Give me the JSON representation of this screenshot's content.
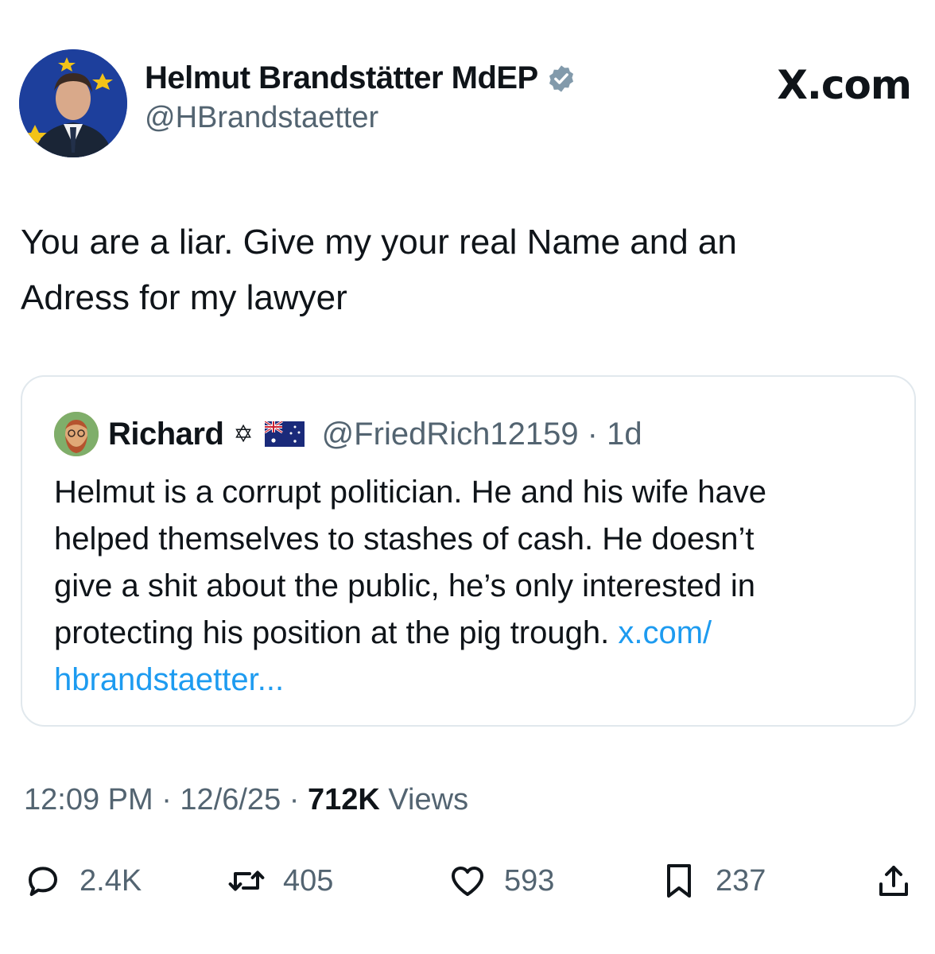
{
  "author": {
    "display_name": "Helmut Brandstätter MdEP",
    "handle": "@HBrandstaetter",
    "avatar_icon": "profile-photo",
    "verified_icon": "verified-badge-icon"
  },
  "brand": {
    "label": "X.com"
  },
  "tweet": {
    "line1": "You are a liar. Give my your real Name and an",
    "line2": "Adress for my lawyer"
  },
  "quote": {
    "name": "Richard",
    "star_glyph": "✡",
    "flag_icon": "australia-flag-icon",
    "handle_time": "@FriedRich12159 · 1d",
    "lines": [
      "Helmut is a corrupt politician. He and his wife have",
      "helped themselves to stashes of cash. He doesn’t",
      "give a shit about the public, he’s only interested in",
      "protecting his position at the pig trough. "
    ],
    "link_part1": "x.com/",
    "link_part2": "hbrandstaetter..."
  },
  "meta": {
    "time_date": "12:09 PM · 12/6/25 · ",
    "views_count": "712K",
    "views_label": " Views"
  },
  "actions": {
    "replies": "2.4K",
    "reposts": "405",
    "likes": "593",
    "bookmarks": "237"
  },
  "colors": {
    "link": "#1d9bf0",
    "muted": "#536471",
    "text": "#0f1419",
    "border": "#e1e8ed"
  }
}
